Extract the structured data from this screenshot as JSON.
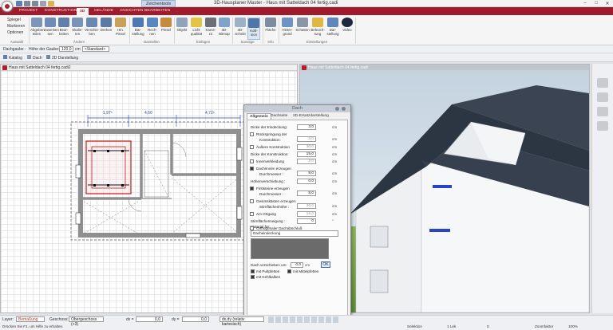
{
  "app": {
    "title": "3D-Hausplaner Master - Haus mit Satteldach 04 fertig.cadi",
    "context_tab": "Zeichentools",
    "accent": "#a01c2c"
  },
  "tabs": [
    "PROJEKT",
    "KONSTRUKTION",
    "3D",
    "GELÄNDE",
    "ANSICHTEN",
    "BEARBEITEN"
  ],
  "ribbon": {
    "left_items": [
      "Spiegel",
      "Markieren",
      "Optionen"
    ],
    "left_group": "Auswahl",
    "buttons": [
      {
        "label": "Abgeben",
        "sub": "teilen"
      },
      {
        "label": "Zuweisen",
        "sub": "sen"
      },
      {
        "label": "Bear-",
        "sub": "beiten"
      },
      {
        "label": "Skalie-",
        "sub": "ren"
      },
      {
        "label": "Verschie-",
        "sub": "ben"
      },
      {
        "label": "Drehen",
        "sub": ""
      },
      {
        "label": "Hin.",
        "sub": "Pinsel"
      },
      {
        "label": "Dar-",
        "sub": "stellung"
      },
      {
        "label": "Rech-",
        "sub": "nen"
      },
      {
        "label": "Pinsel",
        "sub": ""
      },
      {
        "label": "Objekt",
        "sub": ""
      },
      {
        "label": "Licht",
        "sub": "qualität"
      },
      {
        "label": "Kame-",
        "sub": "ra"
      },
      {
        "label": "3D-",
        "sub": "Bitmap"
      },
      {
        "label": "3D-",
        "sub": "Schnitt"
      },
      {
        "label": "Kolli-",
        "sub": "sion"
      },
      {
        "label": "Fläche",
        "sub": ""
      },
      {
        "label": "Hinter-",
        "sub": "grund"
      },
      {
        "label": "Schatten",
        "sub": ""
      },
      {
        "label": "Beleuch-",
        "sub": "tung"
      },
      {
        "label": "Dar-",
        "sub": "stellung"
      },
      {
        "label": "Video",
        "sub": ""
      }
    ],
    "groups": [
      "Ändern",
      "Darstellen",
      "Einfügen",
      "Sonstige",
      "Info",
      "Einstellungen"
    ]
  },
  "optionbar": {
    "dachgaube_label": "Dachgaube :",
    "hoehe_label": "Höhe der Gaube:",
    "hoehe_value": "120,0",
    "style_value": "<Standard>"
  },
  "toolbar2": [
    "Katalog",
    "Dach",
    "2D Darstellung"
  ],
  "window_plan": {
    "title": "Haus mit Satteldach 04 fertig.cadi2",
    "dims": [
      "1,97⁵",
      "4,60",
      "4,72⁵"
    ]
  },
  "window_3d": {
    "title": "Haus mit Satteldach 04 fertig.cadi"
  },
  "dialog": {
    "title": "Dach",
    "tabs": [
      "Allgemein",
      "Dachseite",
      "2D-Ersatzdarstellung"
    ],
    "rows": [
      {
        "label": "Dicke der Eindeckung:",
        "value": "3,0",
        "unit": "cm",
        "check": null
      },
      {
        "label": "Rückspringung der",
        "label2": "Konstruktion:",
        "value": "3,0",
        "unit": "cm",
        "check": false
      },
      {
        "label": "Äußere Konstruktion",
        "value": "30,0",
        "unit": "cm",
        "check": false
      },
      {
        "label": "Dicke der Konstruktion:",
        "value": "15,0",
        "unit": "cm",
        "check": null
      },
      {
        "label": "Innenverkleidung",
        "value": "2,0",
        "unit": "cm",
        "check": false
      },
      {
        "label": "Dachrinnen erzeugen",
        "label2": "Durchmesser :",
        "value": "8,0",
        "unit": "cm",
        "check": true
      },
      {
        "label": "Höhenverschiebung :",
        "value": "0,0",
        "unit": "cm",
        "check": null
      },
      {
        "label": "Firststeine erzeugen",
        "label2": "Durchmesser :",
        "value": "8,0",
        "unit": "cm",
        "check": true
      },
      {
        "label": "Gesimskästen erzeugen",
        "label2": "Stirnflächenhöhe :",
        "value": "20,0",
        "unit": "cm",
        "check": false
      },
      {
        "label": "Am Ortgang",
        "value": "15,0",
        "unit": "cm",
        "check": false
      },
      {
        "label": "Stirnflächenneigung :",
        "value": "0",
        "unit": "°",
        "check": null
      },
      {
        "label": "Orthogonaler Dachabschluß",
        "value": "",
        "unit": "",
        "check": false
      }
    ],
    "material_label": "Material für:",
    "material_value": "Dacheindeckung",
    "shift_label": "Dach verschieben um:",
    "shift_value": "0,0",
    "shift_unit": "cm",
    "ok": "OK",
    "checks": [
      {
        "label": "mit Pultpfetten",
        "checked": true
      },
      {
        "label": "mit Mittelpfetten",
        "checked": true
      },
      {
        "label": "mit Kehlbalken",
        "checked": true
      }
    ]
  },
  "status": {
    "layer_label": "Layer:",
    "layer_value": "Bemaßung",
    "floor_label": "Geschoss:",
    "floor_value": "Obergeschoss (+3)",
    "dx_label": "dx =",
    "dx_value": "0,0",
    "dy_label": "dy =",
    "dy_value": "0,0",
    "mode_value": "dx,dy (relativ kartesisch)",
    "hint": "Drücken Sie F1, um Hilfe zu erhalten.",
    "selection": "Selektion",
    "count": "1 Lek",
    "num": "0",
    "zoom_label": "Zoomfaktor",
    "zoom_value": "100%"
  }
}
